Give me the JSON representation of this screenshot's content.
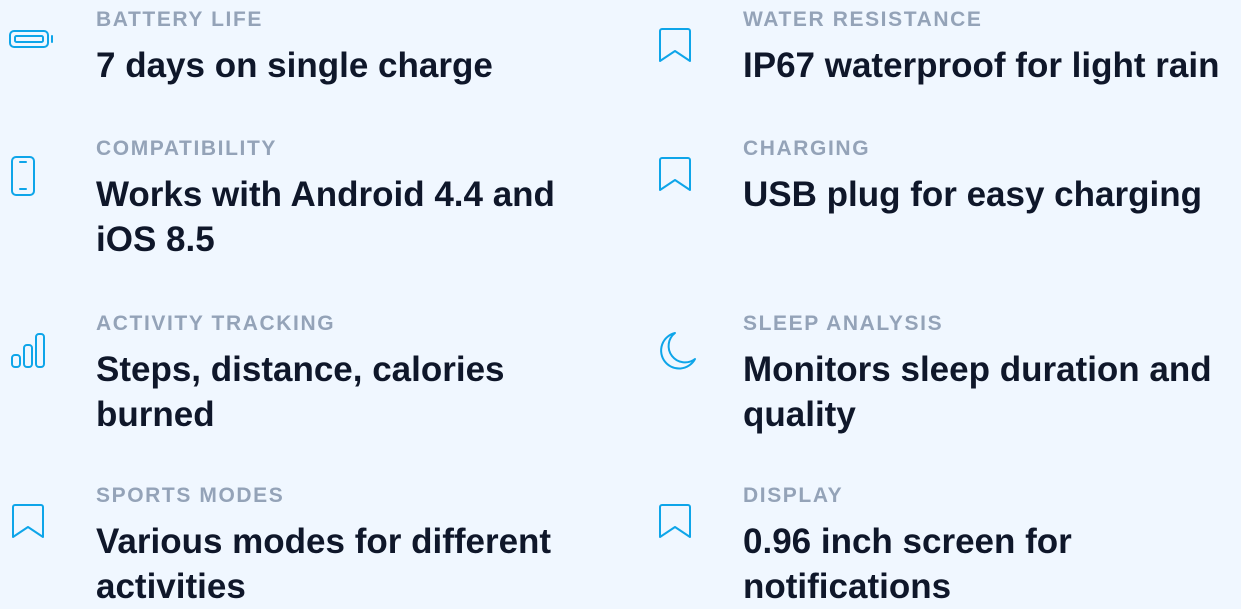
{
  "features": [
    {
      "id": "battery",
      "icon": "battery-icon",
      "label": "BATTERY LIFE",
      "value": "7 days on single charge"
    },
    {
      "id": "compat",
      "icon": "phone-icon",
      "label": "COMPATIBILITY",
      "value": "Works with Android 4.4 and iOS 8.5"
    },
    {
      "id": "activity",
      "icon": "bar-chart-icon",
      "label": "ACTIVITY TRACKING",
      "value": "Steps, distance, calories burned"
    },
    {
      "id": "sports",
      "icon": "bookmark-icon",
      "label": "SPORTS MODES",
      "value": "Various modes for different activities"
    },
    {
      "id": "water",
      "icon": "bookmark-icon",
      "label": "WATER RESISTANCE",
      "value": "IP67 waterproof for light rain"
    },
    {
      "id": "charging",
      "icon": "bookmark-icon",
      "label": "CHARGING",
      "value": "USB plug for easy charging"
    },
    {
      "id": "sleep",
      "icon": "moon-icon",
      "label": "SLEEP ANALYSIS",
      "value": "Monitors sleep duration and quality"
    },
    {
      "id": "display",
      "icon": "bookmark-icon",
      "label": "DISPLAY",
      "value": "0.96 inch screen for notifications"
    }
  ],
  "colors": {
    "background": "#f0f7ff",
    "accent": "#0ea5e9",
    "label": "#94a3b8",
    "value": "#0f172a"
  }
}
